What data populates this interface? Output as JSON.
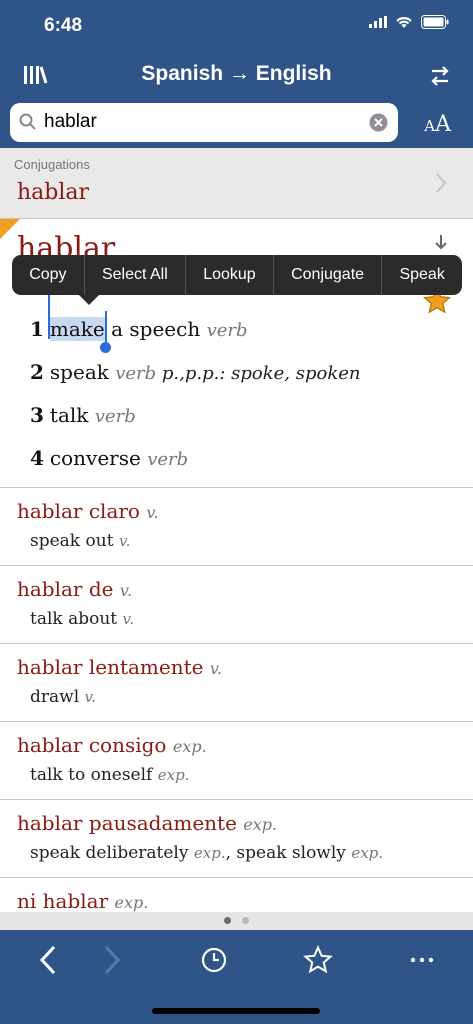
{
  "status": {
    "time": "6:48"
  },
  "nav": {
    "title": "Spanish → English"
  },
  "search": {
    "value": "hablar"
  },
  "conjugations": {
    "label": "Conjugations",
    "word": "hablar"
  },
  "entry": {
    "headword": "hablar",
    "senses": [
      {
        "num": "1",
        "selected": "make",
        "text": " a speech ",
        "pos": "verb"
      },
      {
        "num": "2",
        "text": "speak ",
        "pos": "verb",
        "extra": " p.,p.p.: spoke, spoken"
      },
      {
        "num": "3",
        "text": "talk ",
        "pos": "verb"
      },
      {
        "num": "4",
        "text": "converse ",
        "pos": "verb"
      }
    ]
  },
  "context_menu": {
    "items": [
      "Copy",
      "Select All",
      "Lookup",
      "Conjugate",
      "Speak"
    ]
  },
  "results": [
    {
      "head": "hablar claro ",
      "head_pos": "v.",
      "def": "speak out ",
      "def_pos": "v."
    },
    {
      "head": "hablar de ",
      "head_pos": "v.",
      "def": "talk about ",
      "def_pos": "v."
    },
    {
      "head": "hablar lentamente ",
      "head_pos": "v.",
      "def": "drawl ",
      "def_pos": "v."
    },
    {
      "head": "hablar consigo ",
      "head_pos": "exp.",
      "def": "talk to oneself ",
      "def_pos": "exp."
    },
    {
      "head": "hablar pausadamente ",
      "head_pos": "exp.",
      "def": "speak deliberately ",
      "def_pos": "exp.",
      "def2": ", speak slowly ",
      "def2_pos": "exp."
    },
    {
      "head": "ni hablar ",
      "head_pos": "exp.",
      "def": "",
      "def_pos": ""
    }
  ],
  "colors": {
    "brand": "#2f5487",
    "headword": "#8b1a12",
    "selection": "#2c6bd9",
    "star": "#f0a020"
  }
}
